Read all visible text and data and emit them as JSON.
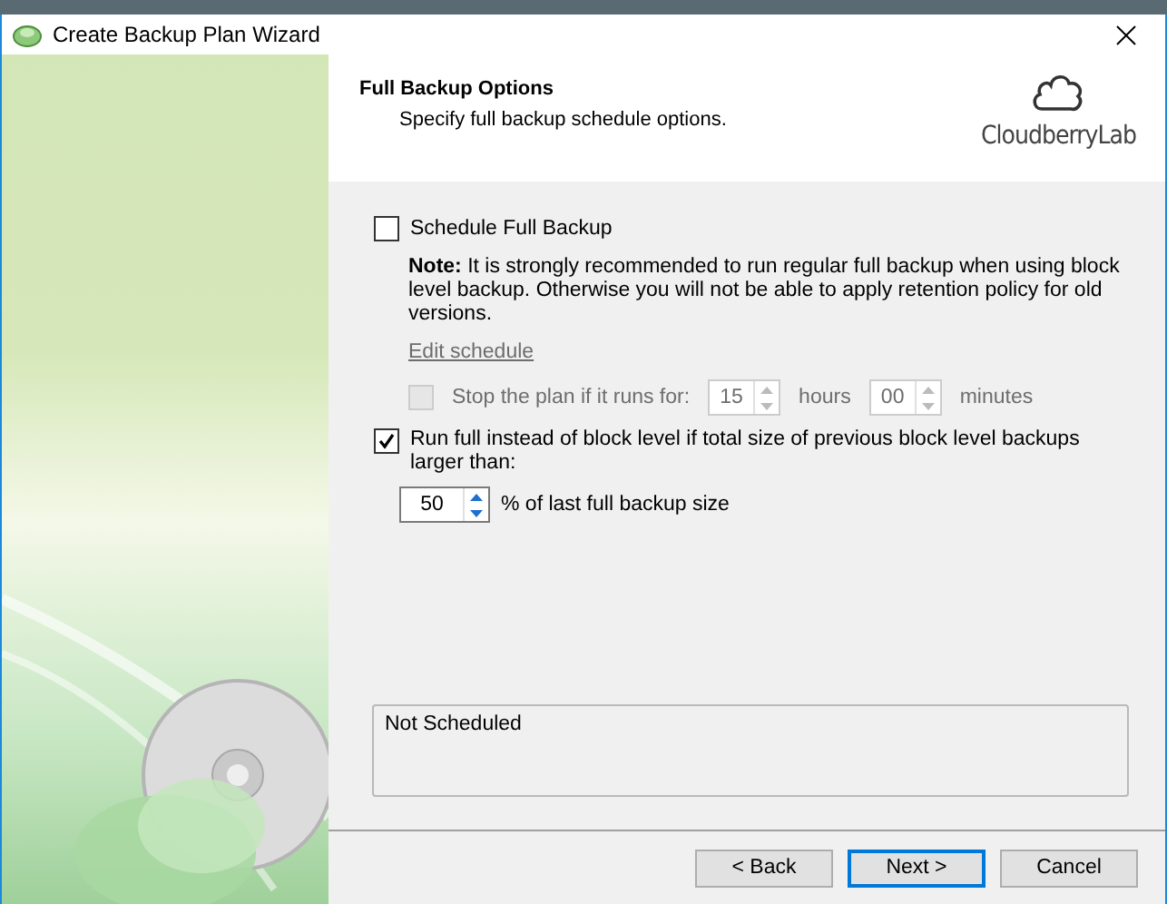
{
  "window": {
    "title": "Create Backup Plan Wizard"
  },
  "header": {
    "title": "Full Backup Options",
    "subtitle": "Specify full backup schedule options.",
    "logo_text": "CloudberryLab"
  },
  "schedule_full": {
    "label": "Schedule Full Backup",
    "checked": false
  },
  "note": "**Note:** It is strongly recommended to run regular full backup when using block level backup. Otherwise you will not be able to apply retention policy for old versions.",
  "edit_schedule": {
    "label": "Edit schedule",
    "disabled": true
  },
  "stop_plan": {
    "label": "Stop the plan if it runs for:",
    "checked": false,
    "disabled": true,
    "hours": "15",
    "hours_unit": "hours",
    "minutes": "00",
    "minutes_unit": "minutes"
  },
  "run_full": {
    "label": "Run full instead of block level if total size of previous block level backups larger than:",
    "checked": true
  },
  "threshold": {
    "value": "50",
    "suffix": "% of last full backup size"
  },
  "status": "Not Scheduled",
  "buttons": [
    {
      "label": "< Back",
      "default": false
    },
    {
      "label": "Next >",
      "default": true
    },
    {
      "label": "Cancel",
      "default": false
    }
  ]
}
